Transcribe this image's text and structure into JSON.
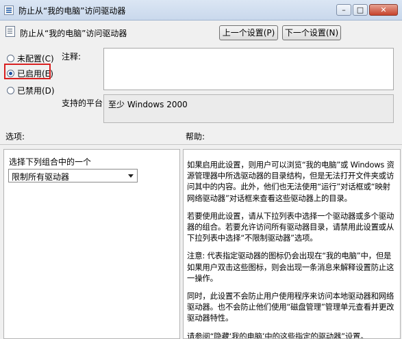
{
  "window": {
    "title": "防止从“我的电脑”访问驱动器",
    "minimize_glyph": "–",
    "maximize_glyph": "□",
    "close_glyph": "✕"
  },
  "header": {
    "title": "防止从“我的电脑”访问驱动器",
    "prev_button": "上一个设置(P)",
    "next_button": "下一个设置(N)"
  },
  "state": {
    "not_configured": "未配置(C)",
    "enabled": "已启用(E)",
    "disabled": "已禁用(D)",
    "selected": "enabled"
  },
  "note_label": "注释:",
  "note_value": "",
  "platform_label": "支持的平台:",
  "platform_value": "至少 Windows 2000",
  "options_label": "选项:",
  "help_label": "帮助:",
  "options": {
    "combo_label": "选择下列组合中的一个",
    "dropdown_value": "限制所有驱动器"
  },
  "help": {
    "p1": "如果启用此设置，则用户可以浏览“我的电脑”或 Windows 资源管理器中所选驱动器的目录结构，但是无法打开文件夹或访问其中的内容。此外，他们也无法使用“运行”对话框或“映射网络驱动器”对话框来查看这些驱动器上的目录。",
    "p2": "若要使用此设置，请从下拉列表中选择一个驱动器或多个驱动器的组合。若要允许访问所有驱动器目录，请禁用此设置或从下拉列表中选择“不限制驱动器”选项。",
    "p3": "注意: 代表指定驱动器的图标仍会出现在“我的电脑”中，但是如果用户双击这些图标，则会出现一条消息来解释设置防止这一操作。",
    "p4": "同时，此设置不会防止用户使用程序来访问本地驱动器和网络驱动器。也不会防止他们使用“磁盘管理”管理单元查看并更改驱动器特性。",
    "p5": "请参阅“隐藏‘我的电脑’中的这些指定的驱动器”设置。"
  }
}
